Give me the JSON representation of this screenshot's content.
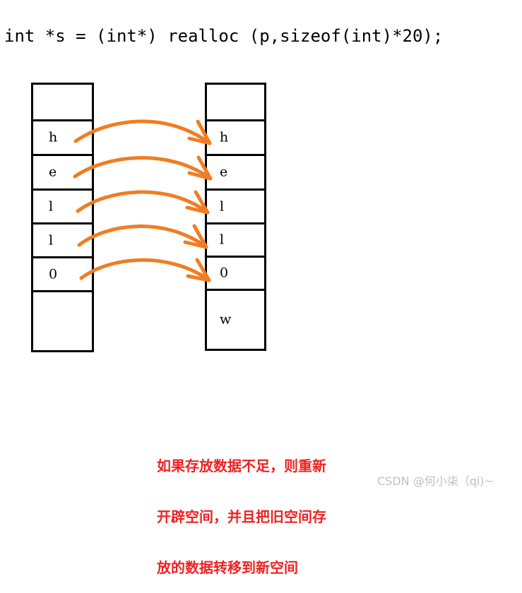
{
  "code": {
    "line": "int *s = (int*) realloc (p,sizeof(int)*20);"
  },
  "colors": {
    "arrow": "#f07d22",
    "caption_red": "#ee2222",
    "box_border": "#000000",
    "watermark_gray": "#bfbfbf",
    "background": "#ffffff"
  },
  "diagram": {
    "old_block": {
      "title": "old-memory-block",
      "cells": [
        {
          "value": ""
        },
        {
          "value": "h"
        },
        {
          "value": "e"
        },
        {
          "value": "l"
        },
        {
          "value": "l"
        },
        {
          "value": "0"
        },
        {
          "value": ""
        }
      ]
    },
    "new_block": {
      "title": "new-memory-block",
      "cells": [
        {
          "value": ""
        },
        {
          "value": "h"
        },
        {
          "value": "e"
        },
        {
          "value": "l"
        },
        {
          "value": "l"
        },
        {
          "value": "0"
        },
        {
          "value": "w"
        }
      ]
    },
    "arrows": [
      {
        "label": "copy-h",
        "from": "h",
        "to": "h"
      },
      {
        "label": "copy-e",
        "from": "e",
        "to": "e"
      },
      {
        "label": "copy-l1",
        "from": "l",
        "to": "l"
      },
      {
        "label": "copy-l2",
        "from": "l",
        "to": "l"
      },
      {
        "label": "copy-0",
        "from": "0",
        "to": "0"
      }
    ]
  },
  "caption": {
    "line1": "如果存放数据不足，则重新",
    "line2": "开辟空间，并且把旧空间存",
    "line3": "放的数据转移到新空间"
  },
  "watermark": {
    "text": "CSDN @何小柒（qi)~"
  }
}
